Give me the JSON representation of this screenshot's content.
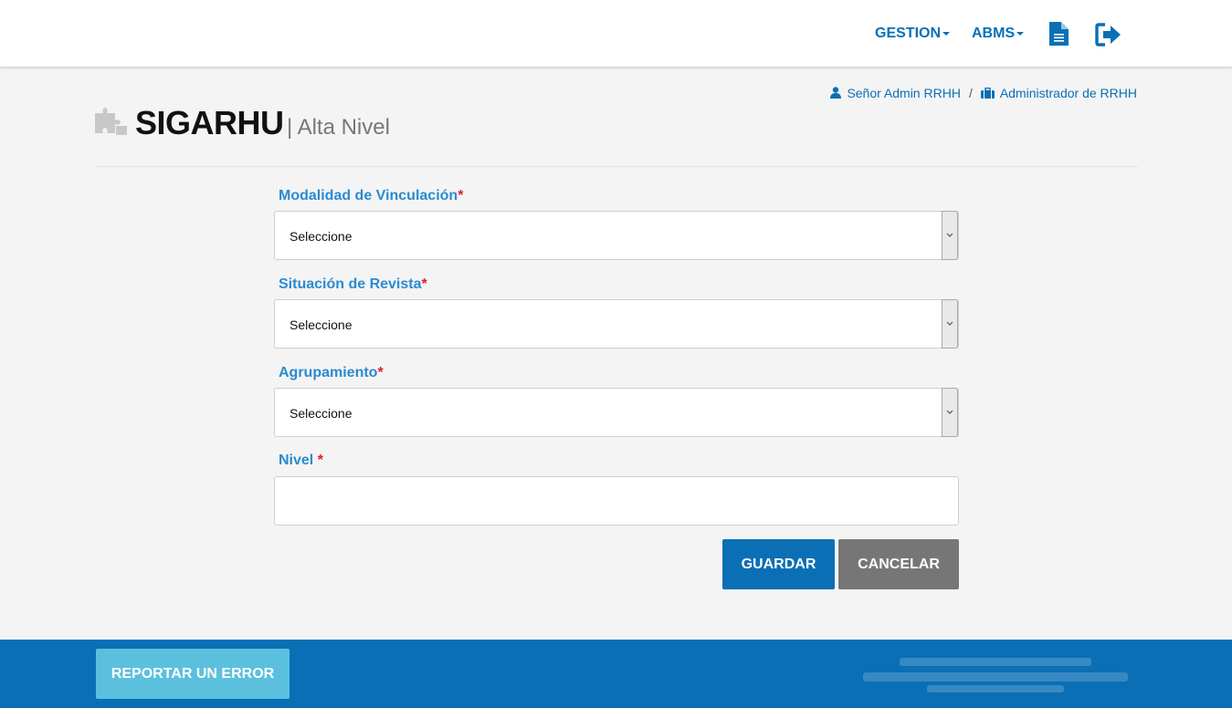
{
  "navbar": {
    "menu": [
      {
        "label": "GESTION"
      },
      {
        "label": "ABMS"
      }
    ],
    "icons": [
      "document-icon",
      "logout-icon"
    ]
  },
  "userbar": {
    "user": "Señor Admin RRHH",
    "separator": "/",
    "role": "Administrador de RRHH",
    "icons": [
      "user-icon",
      "briefcase-icon"
    ]
  },
  "header": {
    "title": "SIGARHU",
    "subtitle": "| Alta Nivel",
    "icon": "puzzle-icon"
  },
  "form": {
    "modalidad": {
      "label": "Modalidad de Vinculación",
      "required": "*",
      "value": "Seleccione"
    },
    "situacion": {
      "label": "Situación de Revista",
      "required": "*",
      "value": "Seleccione"
    },
    "agrupamiento": {
      "label": "Agrupamiento",
      "required": "*",
      "value": "Seleccione"
    },
    "nivel": {
      "label": "Nivel ",
      "required": "*",
      "value": ""
    }
  },
  "actions": {
    "save_label": "GUARDAR",
    "cancel_label": "CANCELAR"
  },
  "footer": {
    "report_label": "REPORTAR UN ERROR"
  },
  "colors": {
    "primary": "#0a6fb5",
    "label": "#2a8bd1",
    "required": "#e31b23",
    "cancel": "#767676",
    "report": "#5bc0de"
  }
}
